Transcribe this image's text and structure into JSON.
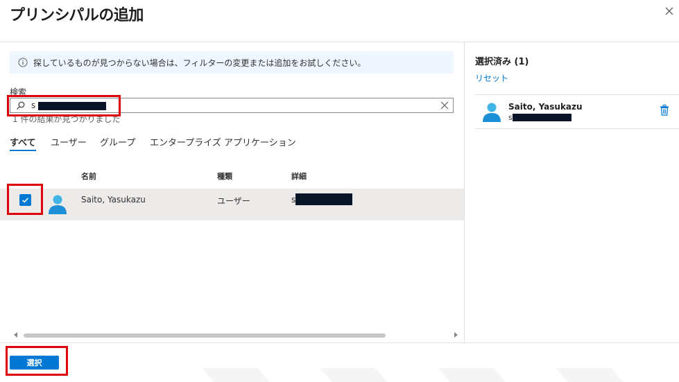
{
  "dialog": {
    "title": "プリンシパルの追加"
  },
  "info_bar": {
    "text": "探しているものが見つからない場合は、フィルターの変更または追加をお試しください。"
  },
  "search": {
    "label": "検索",
    "value": "s",
    "result_count": "1 件の結果が見つかりました"
  },
  "tabs": [
    {
      "label": "すべて",
      "active": true
    },
    {
      "label": "ユーザー",
      "active": false
    },
    {
      "label": "グループ",
      "active": false
    },
    {
      "label": "エンタープライズ アプリケーション",
      "active": false
    }
  ],
  "table": {
    "columns": [
      "名前",
      "種類",
      "詳細"
    ],
    "rows": [
      {
        "checked": true,
        "name": "Saito, Yasukazu",
        "type": "ユーザー",
        "detail": "s"
      }
    ]
  },
  "selected": {
    "heading": "選択済み (1)",
    "reset_label": "リセット",
    "items": [
      {
        "name": "Saito, Yasukazu",
        "detail": "s"
      }
    ]
  },
  "footer": {
    "select_label": "選択"
  },
  "colors": {
    "accent": "#0078d4",
    "highlight": "#e0000b",
    "row_selected": "#edebe9",
    "info_bg": "#f0f6ff"
  }
}
